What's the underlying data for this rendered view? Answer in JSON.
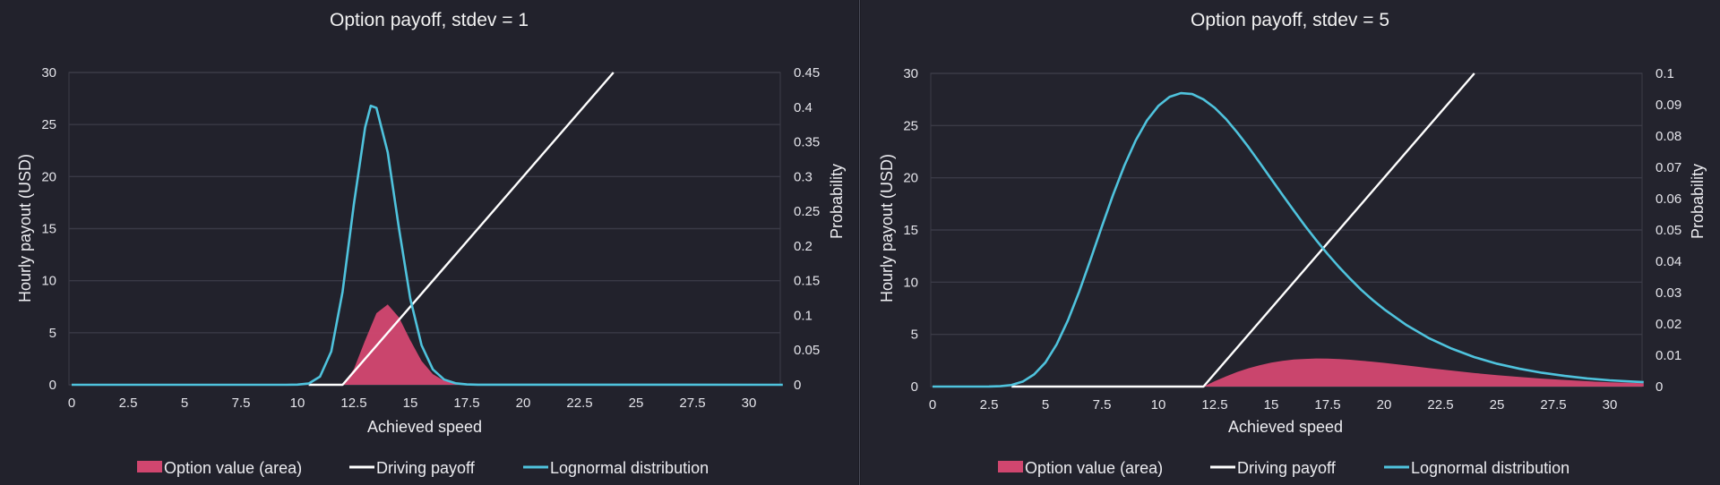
{
  "chart_data": [
    {
      "type": "area+line",
      "title": "Option payoff, stdev = 1",
      "xlabel": "Achieved speed",
      "ylabel": "Hourly payout (USD)",
      "y2label": "Probability",
      "xlim": [
        0,
        31.5
      ],
      "ylim": [
        0,
        30
      ],
      "y2lim": [
        0,
        0.45
      ],
      "xticks": [
        "0",
        "2.5",
        "5",
        "7.5",
        "10",
        "12.5",
        "15",
        "17.5",
        "20",
        "22.5",
        "25",
        "27.5",
        "30"
      ],
      "yticks": [
        "0",
        "5",
        "10",
        "15",
        "20",
        "25",
        "30"
      ],
      "y2ticks": [
        "0",
        "0.05",
        "0.1",
        "0.15",
        "0.2",
        "0.25",
        "0.3",
        "0.35",
        "0.4",
        "0.45"
      ],
      "grid": true,
      "legend_position": "bottom",
      "legend": [
        "Option value (area)",
        "Driving payoff",
        "Lognormal distribution"
      ],
      "series": [
        {
          "name": "Option value (area)",
          "kind": "area",
          "axis": "left",
          "color": "#d0466f",
          "x": [
            0,
            12,
            12.5,
            13,
            13.5,
            14,
            14.5,
            15,
            15.5,
            16,
            16.5,
            17,
            17.5,
            18,
            31.5
          ],
          "y": [
            0,
            0,
            1.5,
            4.27,
            6.88,
            7.71,
            6.47,
            4.28,
            2.29,
            1.02,
            0.39,
            0.13,
            0.04,
            0,
            0
          ]
        },
        {
          "name": "Driving payoff",
          "kind": "line",
          "axis": "left",
          "color": "#ffffff",
          "x": [
            10.5,
            12,
            24
          ],
          "y": [
            0,
            0,
            30
          ]
        },
        {
          "name": "Lognormal distribution",
          "kind": "line",
          "axis": "right",
          "color": "#4fc3dd",
          "x": [
            0,
            9.5,
            10,
            10.5,
            11,
            11.5,
            12,
            12.5,
            13,
            13.25,
            13.5,
            14,
            14.5,
            15,
            15.5,
            16,
            16.5,
            17,
            17.5,
            18,
            31.5
          ],
          "y": [
            0,
            0,
            0.0002,
            0.0018,
            0.0118,
            0.048,
            0.134,
            0.26,
            0.371,
            0.402,
            0.399,
            0.335,
            0.225,
            0.124,
            0.0569,
            0.0222,
            0.0075,
            0.0022,
            0.0006,
            0.0001,
            0
          ]
        }
      ]
    },
    {
      "type": "area+line",
      "title": "Option payoff, stdev = 5",
      "xlabel": "Achieved speed",
      "ylabel": "Hourly payout (USD)",
      "y2label": "Probability",
      "xlim": [
        0,
        31.5
      ],
      "ylim": [
        0,
        30
      ],
      "y2lim": [
        0,
        0.1
      ],
      "xticks": [
        "0",
        "2.5",
        "5",
        "7.5",
        "10",
        "12.5",
        "15",
        "17.5",
        "20",
        "22.5",
        "25",
        "27.5",
        "30"
      ],
      "yticks": [
        "0",
        "5",
        "10",
        "15",
        "20",
        "25",
        "30"
      ],
      "y2ticks": [
        "0",
        "0.01",
        "0.02",
        "0.03",
        "0.04",
        "0.05",
        "0.06",
        "0.07",
        "0.08",
        "0.09",
        "0.1"
      ],
      "grid": true,
      "legend_position": "bottom",
      "legend": [
        "Option value (area)",
        "Driving payoff",
        "Lognormal distribution"
      ],
      "series": [
        {
          "name": "Option value (area)",
          "kind": "area",
          "axis": "left",
          "color": "#d0466f",
          "x": [
            0,
            12,
            12.5,
            13,
            13.5,
            14,
            14.5,
            15,
            15.5,
            16,
            16.5,
            17,
            17.5,
            18,
            18.5,
            19,
            19.5,
            20,
            21,
            22,
            23,
            24,
            25,
            26,
            27,
            28,
            29,
            30,
            31,
            31.5
          ],
          "y": [
            0,
            0,
            0.51,
            0.98,
            1.4,
            1.76,
            2.05,
            2.29,
            2.46,
            2.59,
            2.65,
            2.69,
            2.68,
            2.64,
            2.57,
            2.48,
            2.38,
            2.27,
            2.03,
            1.77,
            1.53,
            1.3,
            1.09,
            0.92,
            0.76,
            0.63,
            0.51,
            0.41,
            0.35,
            0.31
          ]
        },
        {
          "name": "Driving payoff",
          "kind": "line",
          "axis": "left",
          "color": "#ffffff",
          "x": [
            3.5,
            12,
            24
          ],
          "y": [
            0,
            0,
            30
          ]
        },
        {
          "name": "Lognormal distribution",
          "kind": "line",
          "axis": "right",
          "color": "#4fc3dd",
          "x": [
            0,
            2.5,
            3,
            3.5,
            4,
            4.5,
            5,
            5.5,
            6,
            6.5,
            7,
            7.5,
            8,
            8.5,
            9,
            9.5,
            10,
            10.5,
            11,
            11.5,
            12,
            12.5,
            13,
            13.5,
            14,
            14.5,
            15,
            15.5,
            16,
            16.5,
            17,
            17.5,
            18,
            18.5,
            19,
            19.5,
            20,
            21,
            22,
            23,
            24,
            25,
            26,
            27,
            28,
            29,
            30,
            31,
            31.5
          ],
          "y": [
            0,
            2e-05,
            0.00012,
            0.0005,
            0.0016,
            0.0039,
            0.0077,
            0.0135,
            0.0212,
            0.0304,
            0.0406,
            0.0511,
            0.0613,
            0.0706,
            0.0786,
            0.085,
            0.0896,
            0.0925,
            0.0937,
            0.0934,
            0.0917,
            0.089,
            0.0854,
            0.0811,
            0.0764,
            0.0714,
            0.0663,
            0.0612,
            0.0562,
            0.0513,
            0.0467,
            0.0423,
            0.0382,
            0.0344,
            0.0308,
            0.0276,
            0.0247,
            0.0196,
            0.0154,
            0.0121,
            0.0094,
            0.0073,
            0.0057,
            0.0044,
            0.0034,
            0.0026,
            0.002,
            0.0016,
            0.0014
          ]
        }
      ]
    }
  ]
}
